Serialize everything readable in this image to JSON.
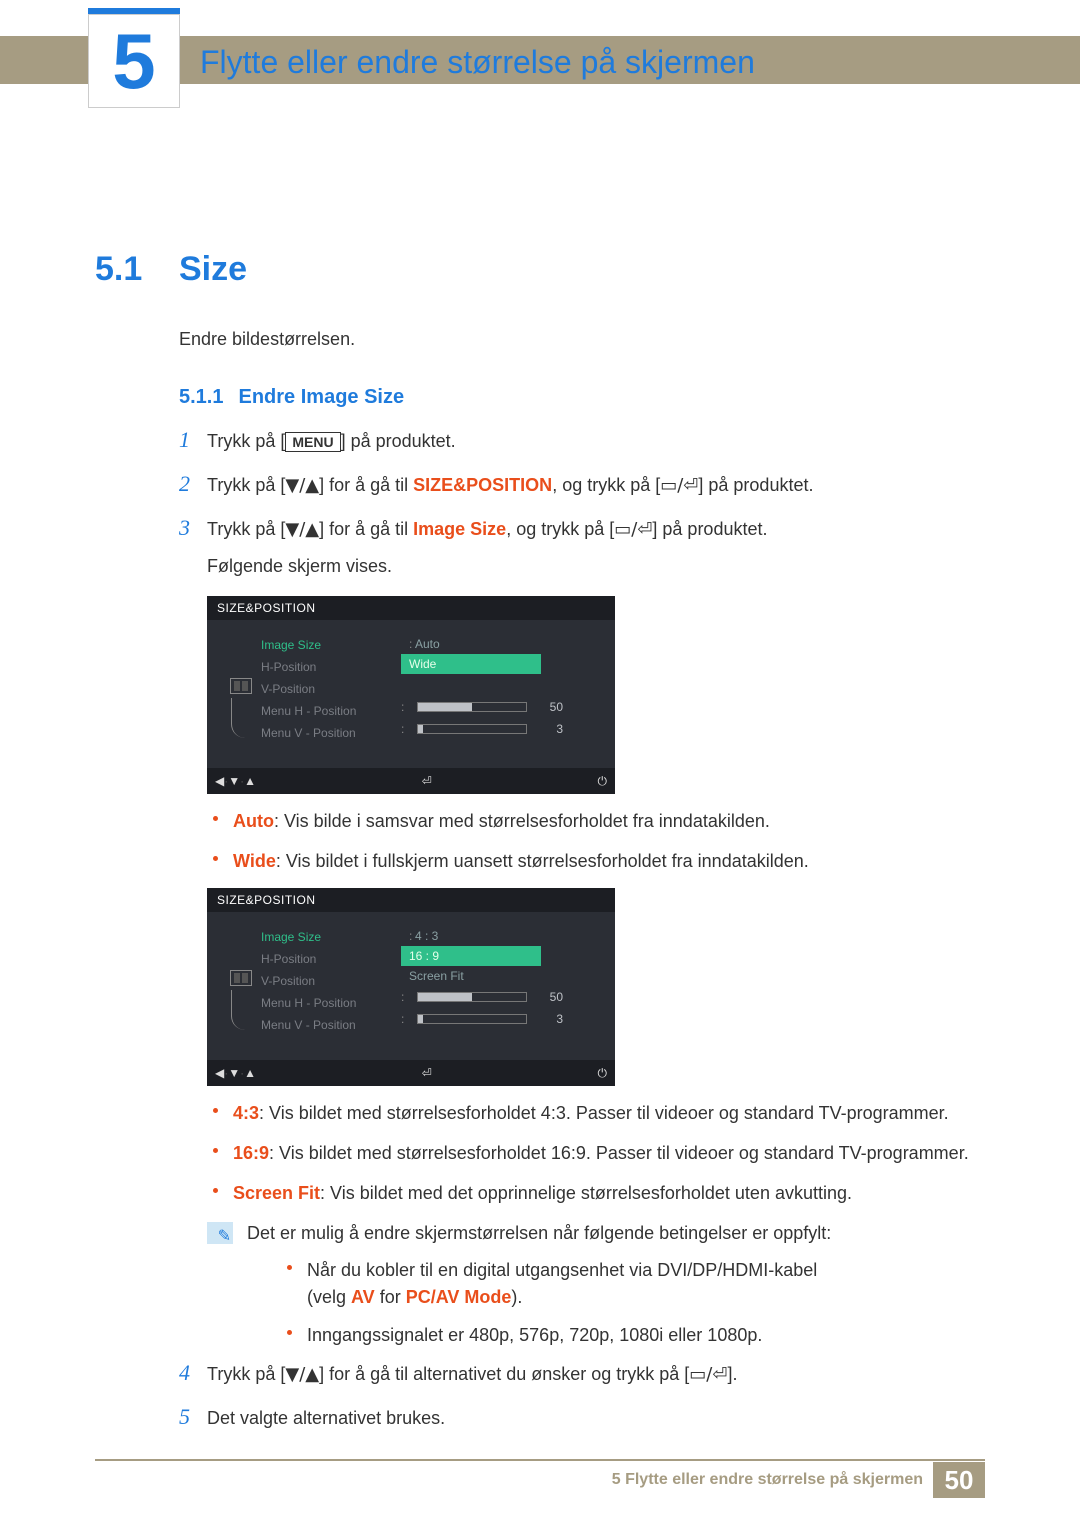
{
  "chapter": {
    "num": "5",
    "title": "Flytte eller endre størrelse på skjermen"
  },
  "section": {
    "num": "5.1",
    "title": "Size",
    "intro": "Endre bildestørrelsen."
  },
  "subsection": {
    "num": "5.1.1",
    "title": "Endre Image Size"
  },
  "buttons": {
    "menu": "MENU"
  },
  "steps": {
    "s1": {
      "num": "1",
      "a": "Trykk på [",
      "b": "] på produktet."
    },
    "s2": {
      "num": "2",
      "a": "Trykk på [",
      "arrows": "▼/▲",
      "b": "] for å gå til ",
      "target": "SIZE&POSITION",
      "c": ", og trykk på [",
      "enter": "▭/⏎",
      "d": "] på produktet."
    },
    "s3": {
      "num": "3",
      "a": "Trykk på [",
      "arrows": "▼/▲",
      "b": "] for å gå til ",
      "target": "Image Size",
      "c": ", og trykk på [",
      "enter": "▭/⏎",
      "d": "] på produktet.",
      "sub": "Følgende skjerm vises."
    },
    "s4": {
      "num": "4",
      "a": "Trykk på [",
      "arrows": "▼/▲",
      "b": "] for å gå til alternativet du ønsker og trykk på [",
      "enter": "▭/⏎",
      "c": "]."
    },
    "s5": {
      "num": "5",
      "text": "Det valgte alternativet brukes."
    }
  },
  "osd": {
    "title": "SIZE&POSITION",
    "labels": {
      "image_size": "Image Size",
      "h_pos": "H-Position",
      "v_pos": "V-Position",
      "menu_h": "Menu H - Position",
      "menu_v": "Menu V - Position"
    },
    "vals": {
      "menu_h": "50",
      "menu_v": "3"
    },
    "opts1": {
      "auto": "Auto",
      "wide": "Wide"
    },
    "opts2": {
      "r43": "4 : 3",
      "r169": "16 : 9",
      "fit": "Screen Fit"
    },
    "footer": {
      "left": "◀",
      "down": "▼",
      "up": "▲",
      "enter": "⏎",
      "power": "⏻"
    }
  },
  "bullets1": {
    "auto_label": "Auto",
    "auto_text": ": Vis bilde i samsvar med størrelsesforholdet fra inndatakilden.",
    "wide_label": "Wide",
    "wide_text": ": Vis bildet i fullskjerm uansett størrelsesforholdet fra inndatakilden."
  },
  "bullets2": {
    "r43_label": "4:3",
    "r43_text": ": Vis bildet med størrelsesforholdet 4:3. Passer til videoer og standard TV-programmer.",
    "r169_label": "16:9",
    "r169_text": ": Vis bildet med størrelsesforholdet 16:9. Passer til videoer og standard TV-programmer.",
    "fit_label": "Screen Fit",
    "fit_text": ": Vis bildet med det opprinnelige størrelsesforholdet uten avkutting."
  },
  "note": {
    "lead": "Det er mulig å endre skjermstørrelsen når følgende betingelser er oppfylt:",
    "b1a": "Når du kobler til en digital utgangsenhet via DVI/DP/HDMI-kabel",
    "b1b_pre": "(velg ",
    "b1b_av": "AV",
    "b1b_mid": " for ",
    "b1b_mode": "PC/AV Mode",
    "b1b_post": ").",
    "b2": "Inngangssignalet er 480p, 576p, 720p, 1080i eller 1080p."
  },
  "footer": {
    "label": "5 Flytte eller endre størrelse på skjermen",
    "page": "50"
  }
}
